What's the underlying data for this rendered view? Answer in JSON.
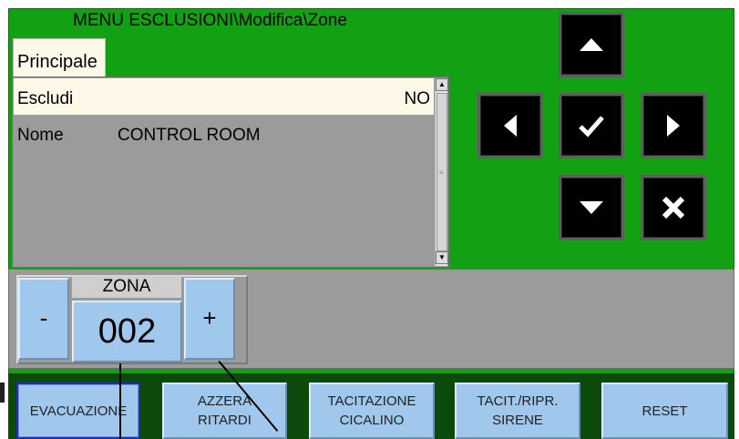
{
  "header": {
    "title": "MENU ESCLUSIONI\\Modifica\\Zone"
  },
  "tabs": [
    {
      "label": "Principale"
    }
  ],
  "list": {
    "rows": [
      {
        "label": "Escludi",
        "value": "NO"
      },
      {
        "label": "Nome",
        "value": "CONTROL ROOM"
      }
    ]
  },
  "nav": {
    "up_icon": "arrow-up-icon",
    "left_icon": "arrow-left-icon",
    "ok_icon": "checkmark-icon",
    "right_icon": "arrow-right-icon",
    "down_icon": "arrow-down-icon",
    "cancel_icon": "x-mark-icon"
  },
  "zone": {
    "label": "ZONA",
    "value": "002",
    "minus_label": "-",
    "plus_label": "+"
  },
  "bottom_bar": {
    "buttons": [
      {
        "label": "EVACUAZIONE",
        "active": true
      },
      {
        "line1": "AZZERA",
        "line2": "RITARDI"
      },
      {
        "line1": "TACITAZIONE",
        "line2": "CICALINO"
      },
      {
        "line1": "TACIT./RIPR.",
        "line2": "SIRENE"
      },
      {
        "label": "RESET"
      }
    ]
  },
  "colors": {
    "panel_green": "#12a112",
    "panel_gray": "#9b9b9b",
    "button_blue": "#9fc8ec",
    "selected_row": "#fdf8e8",
    "nav_button": "#000000"
  }
}
